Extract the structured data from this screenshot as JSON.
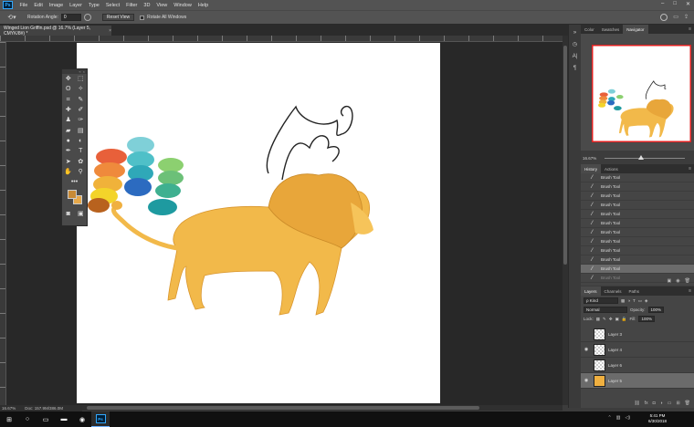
{
  "menubar": {
    "logo": "Ps",
    "items": [
      "File",
      "Edit",
      "Image",
      "Layer",
      "Type",
      "Select",
      "Filter",
      "3D",
      "View",
      "Window",
      "Help"
    ],
    "window_controls": [
      "–",
      "□",
      "✕"
    ]
  },
  "options": {
    "tool_icon": "rotate-view-icon",
    "rotation_label": "Rotation Angle:",
    "rotation_value": "0",
    "reset_view": "Reset View",
    "rotate_all": "Rotate All Windows"
  },
  "document": {
    "tab_title": "Winged Lion Griffin.psd @ 16.7% (Layer 5, CMYK/8#) *",
    "close": "×"
  },
  "status": {
    "zoom": "16.67%",
    "doc_size": "Doc: 157.9M/386.0M"
  },
  "panels": {
    "top_tabs": [
      "Color",
      "Swatches",
      "Navigator"
    ],
    "active_top_tab": "Navigator",
    "navigator_zoom": "16.67%",
    "history_tabs": [
      "History",
      "Actions"
    ],
    "history_items": [
      {
        "label": "Brush Tool",
        "state": "normal"
      },
      {
        "label": "Brush Tool",
        "state": "normal"
      },
      {
        "label": "Brush Tool",
        "state": "normal"
      },
      {
        "label": "Brush Tool",
        "state": "normal"
      },
      {
        "label": "Brush Tool",
        "state": "normal"
      },
      {
        "label": "Brush Tool",
        "state": "normal"
      },
      {
        "label": "Brush Tool",
        "state": "normal"
      },
      {
        "label": "Brush Tool",
        "state": "normal"
      },
      {
        "label": "Brush Tool",
        "state": "normal"
      },
      {
        "label": "Brush Tool",
        "state": "normal"
      },
      {
        "label": "Brush Tool",
        "state": "selected"
      },
      {
        "label": "Brush Tool",
        "state": "faded"
      }
    ],
    "layers_tabs": [
      "Layers",
      "Channels",
      "Paths"
    ],
    "kind_label": "ρ Kind",
    "blend_mode": "Normal",
    "opacity_label": "Opacity:",
    "opacity_value": "100%",
    "lock_label": "Lock:",
    "fill_label": "Fill:",
    "fill_value": "100%",
    "layers": [
      {
        "name": "Layer 3",
        "visible": false,
        "selected": false,
        "art": false
      },
      {
        "name": "Layer 4",
        "visible": true,
        "selected": false,
        "art": false
      },
      {
        "name": "Layer 6",
        "visible": false,
        "selected": false,
        "art": false
      },
      {
        "name": "Layer 5",
        "visible": true,
        "selected": true,
        "art": true
      }
    ]
  },
  "taskbar": {
    "time": "5:41 PM",
    "date": "6/30/2018",
    "ps_label": "Ps"
  },
  "colors": {
    "foreground": "#c88a36",
    "background": "#e6a84a",
    "accent_border": "#e02020"
  }
}
